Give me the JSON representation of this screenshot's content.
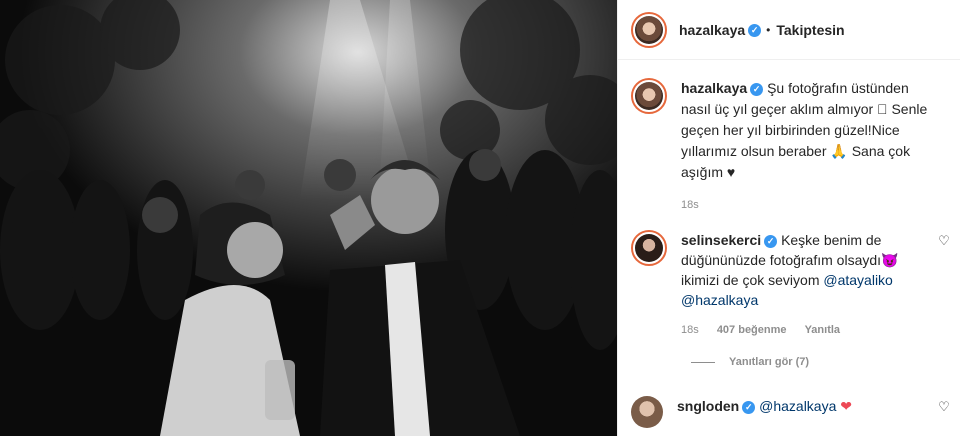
{
  "post": {
    "author": "hazalkaya",
    "follow_status": "Takiptesin",
    "separator": "•",
    "verified_glyph": "✓",
    "caption": {
      "username": "hazalkaya",
      "text": "Şu fotoğrafın üstünden nasıl üç yıl geçer aklım almıyor ⃞ Senle geçen her yıl birbirinden güzel!Nice yıllarımız olsun beraber 🙏 Sana çok aşığım ♥",
      "time": "18s"
    },
    "comments": [
      {
        "username": "selinsekerci",
        "text": "Keşke benim de düğününüzde fotoğrafım olsaydı😈 ikimizi de çok seviyom",
        "mentions": [
          "@atayaliko",
          "@hazalkaya"
        ],
        "time": "18s",
        "likes": "407 beğenme",
        "reply_label": "Yanıtla",
        "like_icon": "heart-outline-icon"
      },
      {
        "username": "sngloden",
        "mention": "@hazalkaya",
        "emoji": "❤",
        "like_icon": "heart-outline-icon"
      }
    ],
    "view_replies": "Yanıtları gör (7)"
  },
  "colors": {
    "accent": "#3897f0",
    "muted": "#8e8e8e",
    "mention": "#00376b",
    "heart": "#ed4956"
  }
}
